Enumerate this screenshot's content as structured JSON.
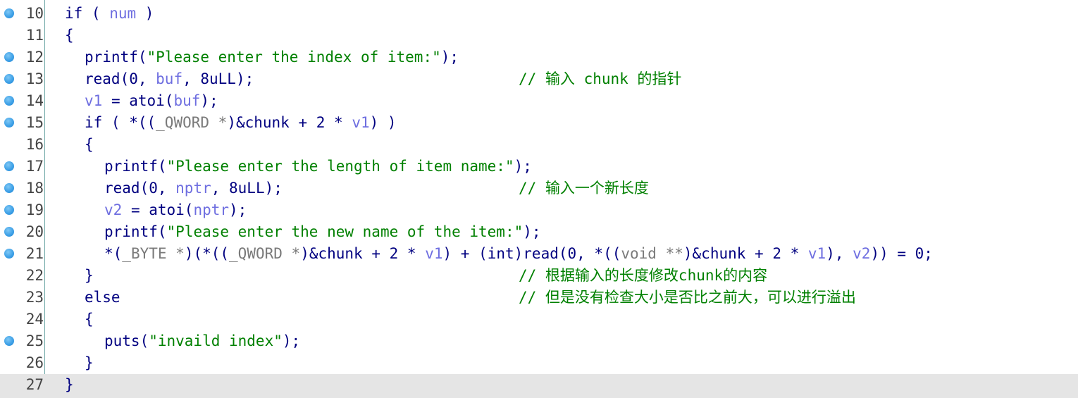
{
  "colors": {
    "keyword": "#000080",
    "string": "#008000",
    "variable": "#6e6ee0",
    "type": "#7a7a7a",
    "comment": "#008000",
    "current_line_bg": "#e5e5e5",
    "breakpoint": "#3a9ee6",
    "gutter_divider": "#6fa8a6"
  },
  "lines": [
    {
      "num": "10",
      "bp": true
    },
    {
      "num": "11",
      "bp": false
    },
    {
      "num": "12",
      "bp": true
    },
    {
      "num": "13",
      "bp": true
    },
    {
      "num": "14",
      "bp": true
    },
    {
      "num": "15",
      "bp": true
    },
    {
      "num": "16",
      "bp": false
    },
    {
      "num": "17",
      "bp": true
    },
    {
      "num": "18",
      "bp": true
    },
    {
      "num": "19",
      "bp": true
    },
    {
      "num": "20",
      "bp": true
    },
    {
      "num": "21",
      "bp": true
    },
    {
      "num": "22",
      "bp": false
    },
    {
      "num": "23",
      "bp": false
    },
    {
      "num": "24",
      "bp": false
    },
    {
      "num": "25",
      "bp": true
    },
    {
      "num": "26",
      "bp": false
    },
    {
      "num": "27",
      "bp": false
    }
  ],
  "code": {
    "l10": {
      "kw": "if ( ",
      "var": "num",
      "end": " )"
    },
    "l11": {
      "text": "{"
    },
    "l12": {
      "fn": "printf(",
      "str": "\"Please enter the index of item:\"",
      "end": ");"
    },
    "l13": {
      "fn": "read(0, ",
      "var": "buf",
      "end": ", 8uLL);"
    },
    "l14": {
      "var": "v1",
      "mid": " = atoi(",
      "var2": "buf",
      "end": ");"
    },
    "l15": {
      "a": "if ( *((",
      "typ": "_QWORD *",
      "b": ")&chunk + 2 * ",
      "var": "v1",
      "end": ") )"
    },
    "l16": {
      "text": "{"
    },
    "l17": {
      "fn": "printf(",
      "str": "\"Please enter the length of item name:\"",
      "end": ");"
    },
    "l18": {
      "fn": "read(0, ",
      "var": "nptr",
      "end": ", 8uLL);"
    },
    "l19": {
      "var": "v2",
      "mid": " = atoi(",
      "var2": "nptr",
      "end": ");"
    },
    "l20": {
      "fn": "printf(",
      "str": "\"Please enter the new name of the item:\"",
      "end": ");"
    },
    "l21": {
      "a": "*(",
      "typ1": "_BYTE *",
      "b": ")(*((",
      "typ2": "_QWORD *",
      "c": ")&chunk + 2 * ",
      "var1": "v1",
      "d": ") + (int)read(0, *((",
      "typ3": "void **",
      "e": ")&chunk + 2 * ",
      "var2": "v1",
      "f": "), ",
      "var3": "v2",
      "g": ")) = 0;"
    },
    "l22": {
      "text": "}"
    },
    "l23": {
      "text": "else"
    },
    "l24": {
      "text": "{"
    },
    "l25": {
      "fn": "puts(",
      "str": "\"invaild index\"",
      "end": ");"
    },
    "l26": {
      "text": "}"
    },
    "l27": {
      "text": "}"
    }
  },
  "comments": {
    "l13": "// 输入 chunk 的指针",
    "l18": "// 输入一个新长度",
    "l22": "// 根据输入的长度修改chunk的内容",
    "l23": "// 但是没有检查大小是否比之前大，可以进行溢出"
  }
}
